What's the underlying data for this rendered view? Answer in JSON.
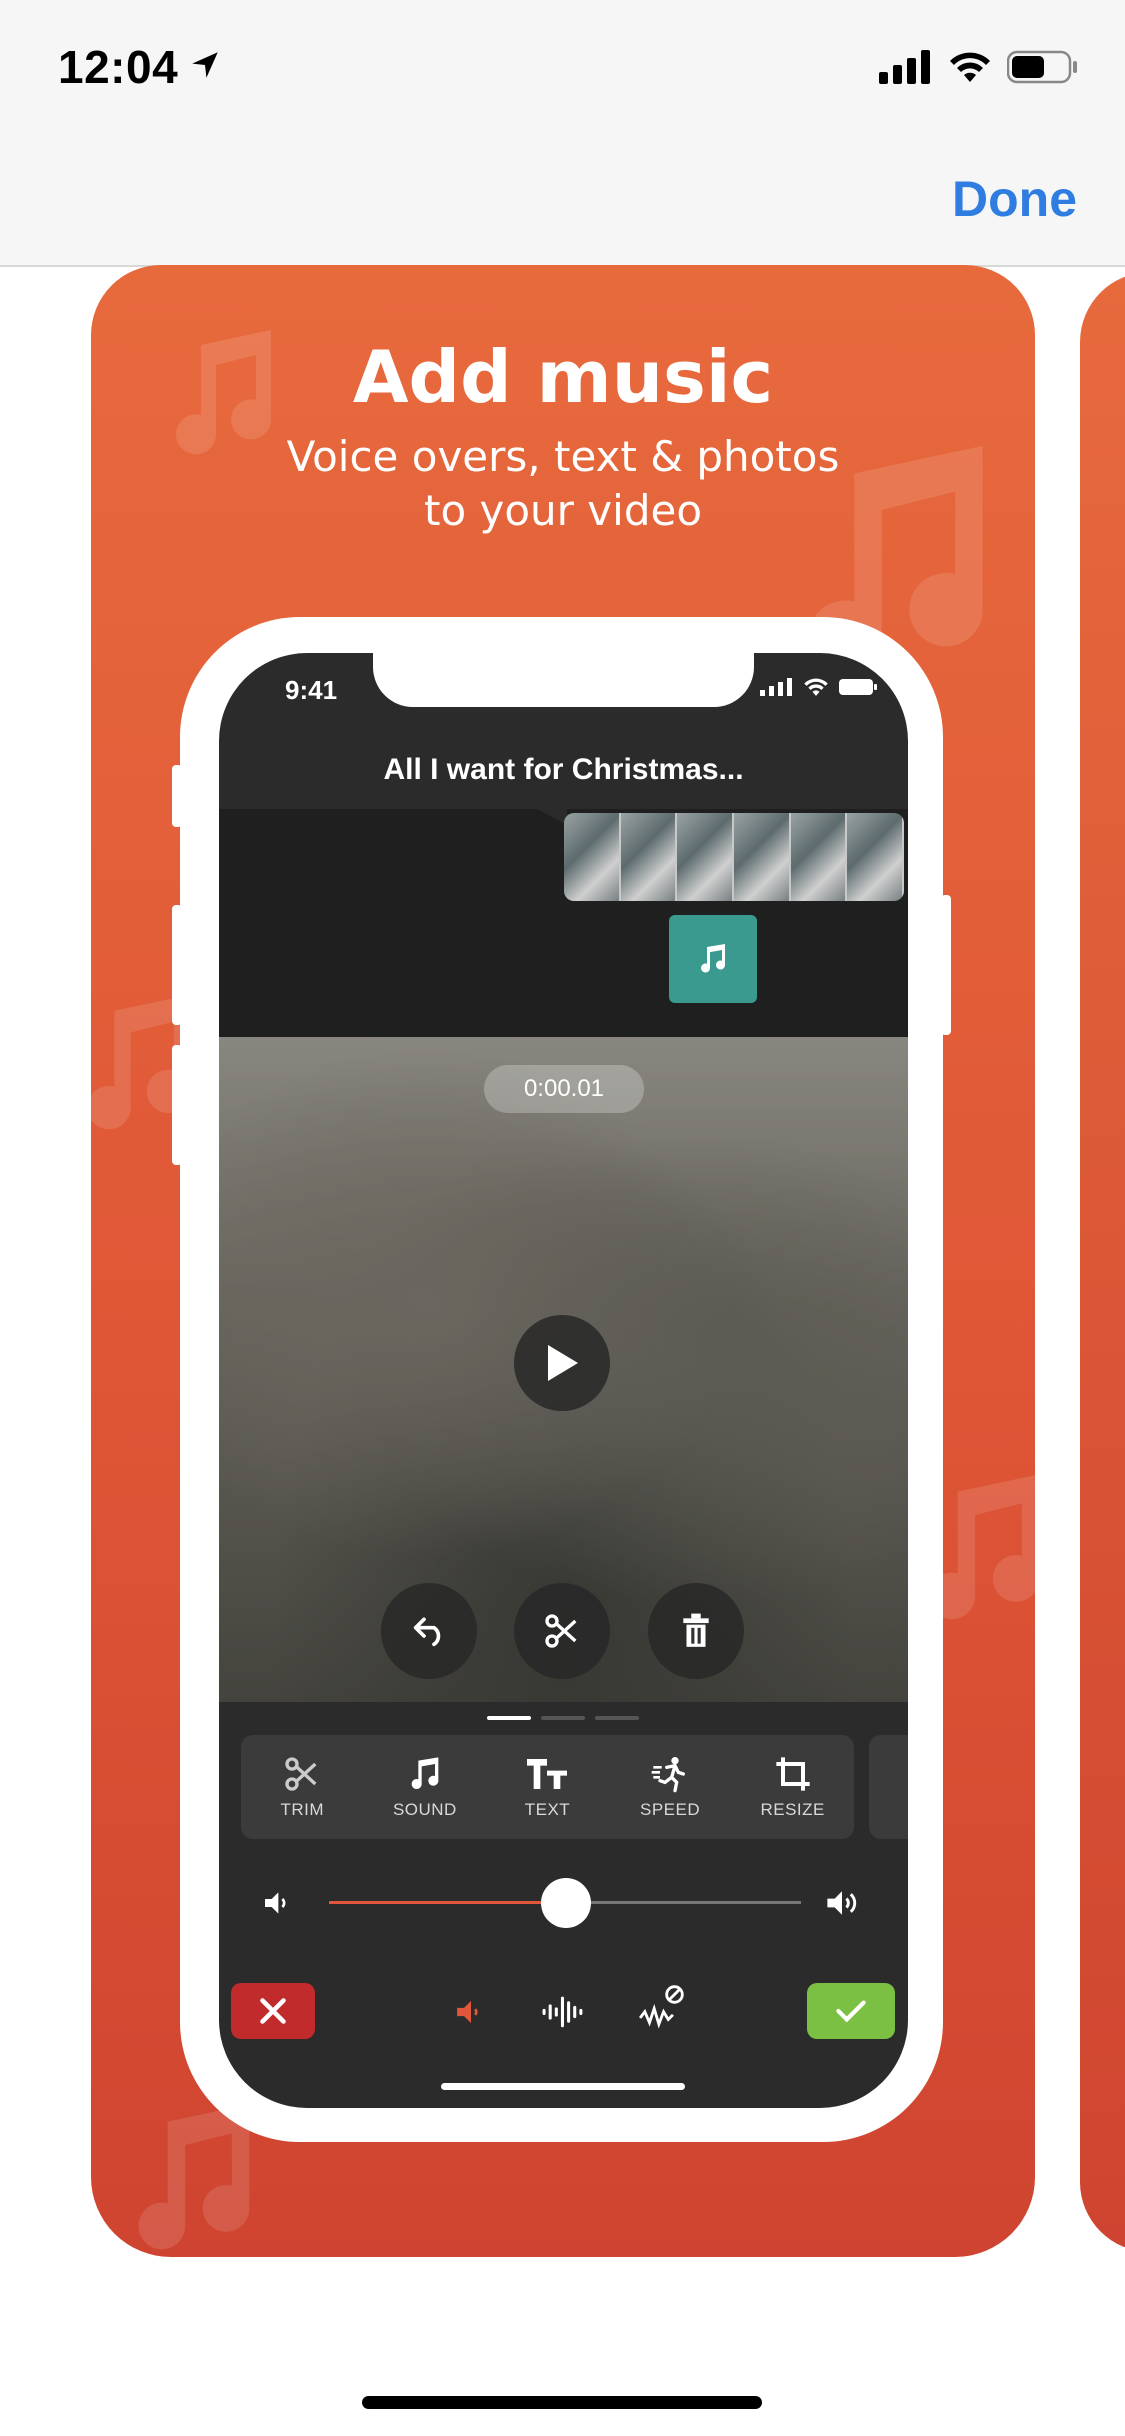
{
  "status_bar": {
    "time": "12:04"
  },
  "nav": {
    "done_label": "Done"
  },
  "card": {
    "title": "Add music",
    "subtitle_line1": "Voice overs, text & photos",
    "subtitle_line2": "to your video"
  },
  "phone": {
    "time": "9:41",
    "clip_title": "All I want for Christmas...",
    "timecode": "0:00.01",
    "tools": [
      {
        "label": "TRIM",
        "icon": "scissors-icon"
      },
      {
        "label": "SOUND",
        "icon": "music-note-icon"
      },
      {
        "label": "TEXT",
        "icon": "text-icon"
      },
      {
        "label": "SPEED",
        "icon": "running-icon"
      },
      {
        "label": "RESIZE",
        "icon": "crop-icon"
      }
    ],
    "volume_fraction": 0.5
  },
  "colors": {
    "card_gradient_top": "#e76a3d",
    "card_gradient_bottom": "#cf4430",
    "accent_blue": "#2f7de1",
    "music_marker": "#3a9a8f",
    "cancel": "#c22b2b",
    "confirm": "#7cc043",
    "volume_track": "#e2563b"
  }
}
